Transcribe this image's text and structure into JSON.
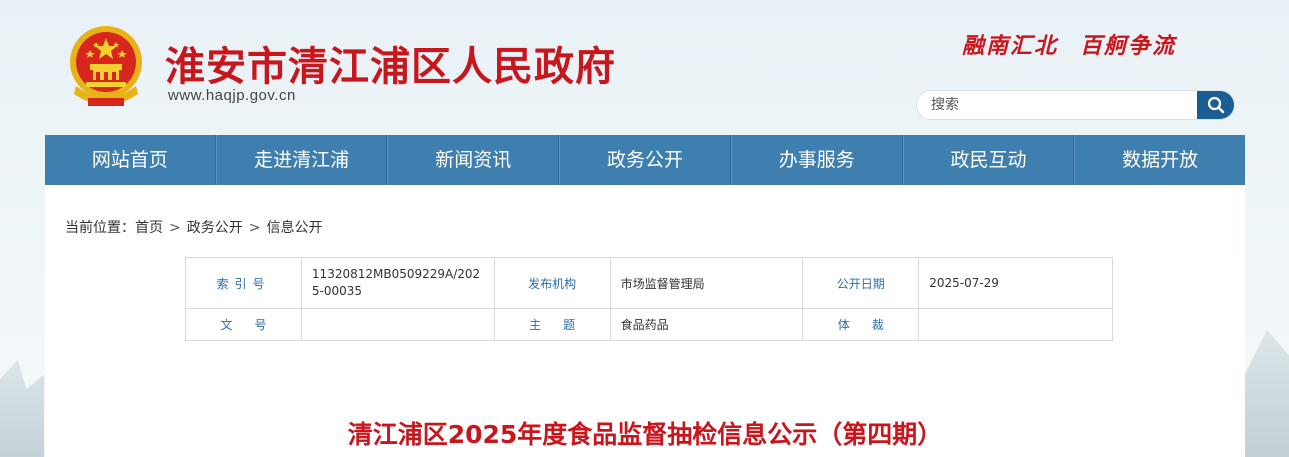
{
  "header": {
    "site_title": "淮安市清江浦区人民政府",
    "site_url": "www.haqjp.gov.cn",
    "slogan_left": "融南汇北",
    "slogan_right": "百舸争流",
    "search": {
      "placeholder": "搜索"
    }
  },
  "nav": {
    "items": [
      "网站首页",
      "走进清江浦",
      "新闻资讯",
      "政务公开",
      "办事服务",
      "政民互动",
      "数据开放"
    ]
  },
  "breadcrumb": {
    "prefix": "当前位置：",
    "items": [
      "首页",
      "政务公开",
      "信息公开"
    ],
    "separator": ">"
  },
  "meta_table": {
    "index_label": "索引号",
    "index_value": "11320812MB0509229A/2025-00035",
    "org_label": "发布机构",
    "org_value": "市场监督管理局",
    "date_label": "公开日期",
    "date_value": "2025-07-29",
    "doc_no_label": "文号",
    "doc_no_value": "",
    "topic_label": "主题",
    "topic_value": "食品药品",
    "genre_label": "体裁",
    "genre_value": ""
  },
  "article": {
    "title": "清江浦区2025年度食品监督抽检信息公示（第四期）"
  },
  "colors": {
    "brand_red": "#c8161d",
    "nav_blue": "#3f7fb0",
    "search_button": "#1b5e93",
    "label_blue": "#2a6ea8"
  },
  "icons": {
    "emblem": "national-emblem-icon",
    "search": "search-icon"
  }
}
